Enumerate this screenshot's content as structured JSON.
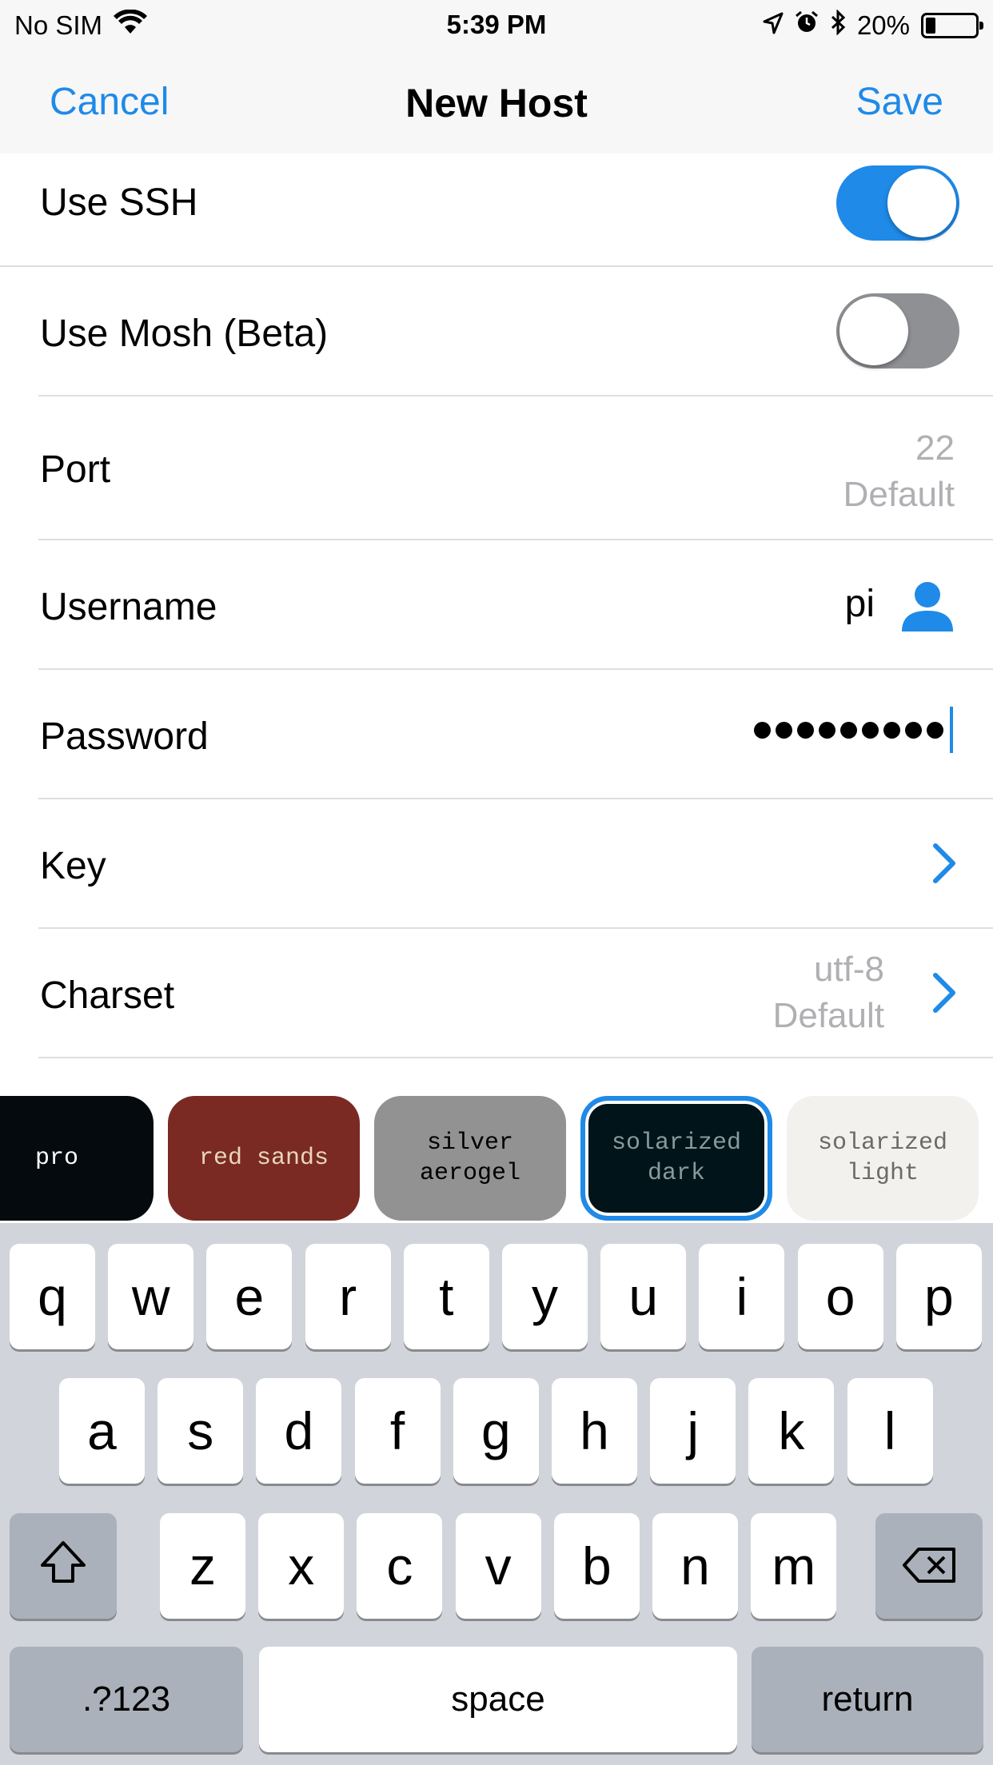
{
  "status_bar": {
    "carrier": "No SIM",
    "time": "5:39 PM",
    "battery": "20%",
    "battery_level": 0.2,
    "icons": [
      "wifi-icon",
      "location-arrow-icon",
      "alarm-icon",
      "bluetooth-icon",
      "battery-icon"
    ]
  },
  "nav": {
    "cancel": "Cancel",
    "title": "New Host",
    "save": "Save"
  },
  "form": {
    "use_ssh": {
      "label": "Use SSH",
      "on": true
    },
    "use_mosh": {
      "label": "Use Mosh (Beta)",
      "on": false
    },
    "port": {
      "label": "Port",
      "value": "22",
      "hint": "Default"
    },
    "username": {
      "label": "Username",
      "value": "pi"
    },
    "password": {
      "label": "Password",
      "masked_length": 9
    },
    "key": {
      "label": "Key"
    },
    "charset": {
      "label": "Charset",
      "value": "utf-8",
      "hint": "Default"
    }
  },
  "themes": [
    {
      "line1": "pro",
      "line2": "",
      "bg": "#040a0d",
      "fg": "#ffffff"
    },
    {
      "line1": "red sands",
      "line2": "",
      "bg": "#7a2a23",
      "fg": "#e8d6b8"
    },
    {
      "line1": "silver",
      "line2": "aerogel",
      "bg": "#929292",
      "fg": "#000000"
    },
    {
      "line1": "solarized",
      "line2": "dark",
      "bg": "#00141a",
      "fg": "#8a9a9b",
      "selected": true
    },
    {
      "line1": "solarized",
      "line2": "light",
      "bg": "#f3f1ee",
      "fg": "#6c6a68"
    }
  ],
  "keyboard": {
    "row1": [
      "q",
      "w",
      "e",
      "r",
      "t",
      "y",
      "u",
      "i",
      "o",
      "p"
    ],
    "row2": [
      "a",
      "s",
      "d",
      "f",
      "g",
      "h",
      "j",
      "k",
      "l"
    ],
    "row3": [
      "z",
      "x",
      "c",
      "v",
      "b",
      "n",
      "m"
    ],
    "numbers": ".?123",
    "space": "space",
    "return": "return"
  },
  "colors": {
    "accent": "#1f8ae8",
    "toggle_off": "#8e9094",
    "placeholder": "#b0b0b4",
    "keyboard_bg": "#d1d5db"
  }
}
